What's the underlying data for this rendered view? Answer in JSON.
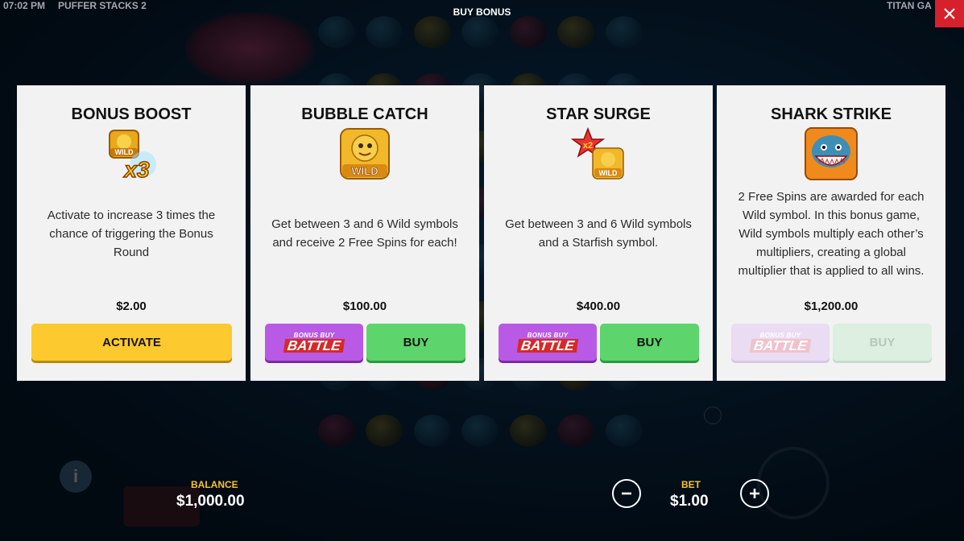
{
  "topbar": {
    "time": "07:02 PM",
    "game_name": "PUFFER STACKS 2",
    "title": "BUY BONUS",
    "provider": "TITAN GA",
    "close_icon": "close-icon"
  },
  "cards": [
    {
      "title": "BONUS BOOST",
      "icon": "wild-x3-icon",
      "icon_text": "x3",
      "description": "Activate to increase 3 times the chance of triggering the Bonus Round",
      "price": "$2.00",
      "primary_label": "ACTIVATE"
    },
    {
      "title": "BUBBLE CATCH",
      "icon": "wild-icon",
      "icon_text": "WILD",
      "description": "Get between 3 and 6 Wild symbols and receive 2 Free Spins for each!",
      "price": "$100.00",
      "battle_small": "BONUS BUY",
      "battle_big": "BATTLE",
      "buy_label": "BUY"
    },
    {
      "title": "STAR SURGE",
      "icon": "starfish-wild-icon",
      "icon_text": "x2",
      "description": "Get between 3 and 6 Wild symbols and a Starfish symbol.",
      "price": "$400.00",
      "battle_small": "BONUS BUY",
      "battle_big": "BATTLE",
      "buy_label": "BUY"
    },
    {
      "title": "SHARK STRIKE",
      "icon": "shark-icon",
      "description": "2 Free Spins are awarded for each Wild symbol. In this bonus game, Wild symbols multiply each other’s multipliers, creating a global multiplier that is applied to all wins.",
      "price": "$1,200.00",
      "battle_small": "BONUS BUY",
      "battle_big": "BATTLE",
      "buy_label": "BUY",
      "disabled": true
    }
  ],
  "footer": {
    "balance_label": "BALANCE",
    "balance_value": "$1,000.00",
    "bet_label": "BET",
    "bet_value": "$1.00",
    "minus_icon": "minus-icon",
    "plus_icon": "plus-icon",
    "info_icon": "info-icon"
  },
  "colors": {
    "accent_yellow": "#fcc92f",
    "buy_green": "#5dd46c",
    "battle_purple": "#b85ae6",
    "close_red": "#d6202b",
    "label_gold": "#f5c232"
  }
}
